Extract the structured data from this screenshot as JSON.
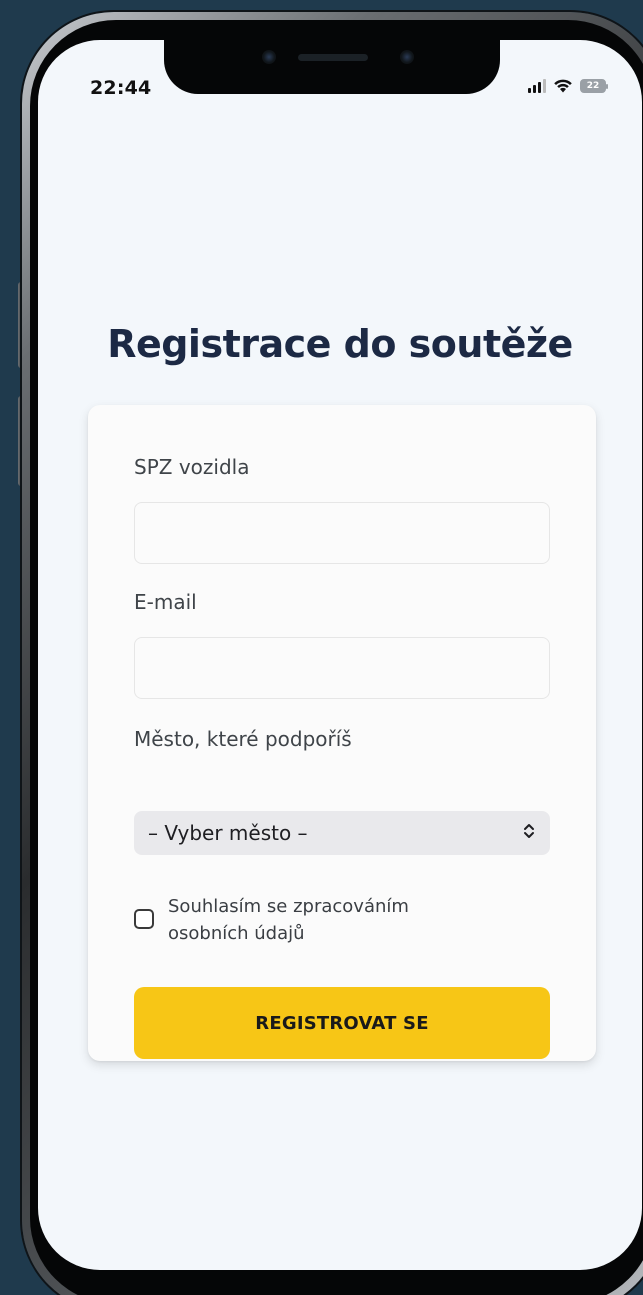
{
  "status_bar": {
    "time": "22:44",
    "battery_level": "22"
  },
  "form": {
    "title": "Registrace do soutěže",
    "spz_label": "SPZ vozidla",
    "spz_value": "",
    "email_label": "E-mail",
    "email_value": "",
    "city_label": "Město, které podpoříš",
    "city_selected": "– Vyber město –",
    "consent_label": "Souhlasím se zpracováním osobních údajů",
    "consent_checked": false,
    "submit_label": "REGISTROVAT SE"
  },
  "colors": {
    "background": "#1f3a4d",
    "screen": "#f3f7fb",
    "title": "#1c2944",
    "button": "#f7c616"
  }
}
